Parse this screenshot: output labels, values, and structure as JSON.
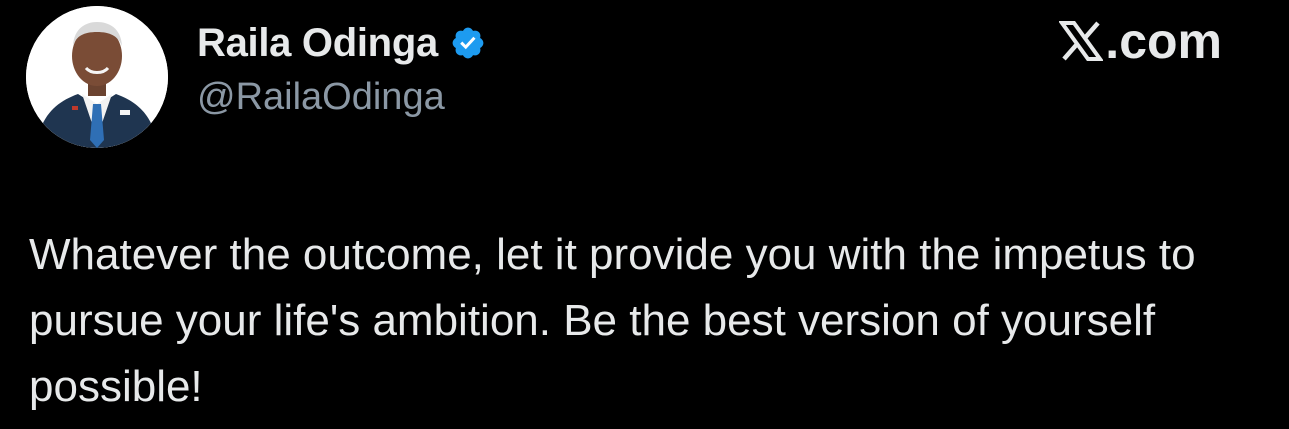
{
  "author": {
    "display_name": "Raila Odinga",
    "handle": "@RailaOdinga",
    "verified_icon": "verified-badge-icon",
    "avatar": "profile-photo"
  },
  "site": {
    "label_suffix": ".com",
    "logo_icon": "x-logo-icon"
  },
  "tweet": {
    "text": "Whatever the outcome, let it provide you with the impetus to pursue your life's ambition. Be the best version of yourself possible!"
  },
  "colors": {
    "background": "#000000",
    "primary_text": "#e7e9ea",
    "secondary_text": "#8b98a5",
    "verified_blue": "#1d9bf0"
  }
}
